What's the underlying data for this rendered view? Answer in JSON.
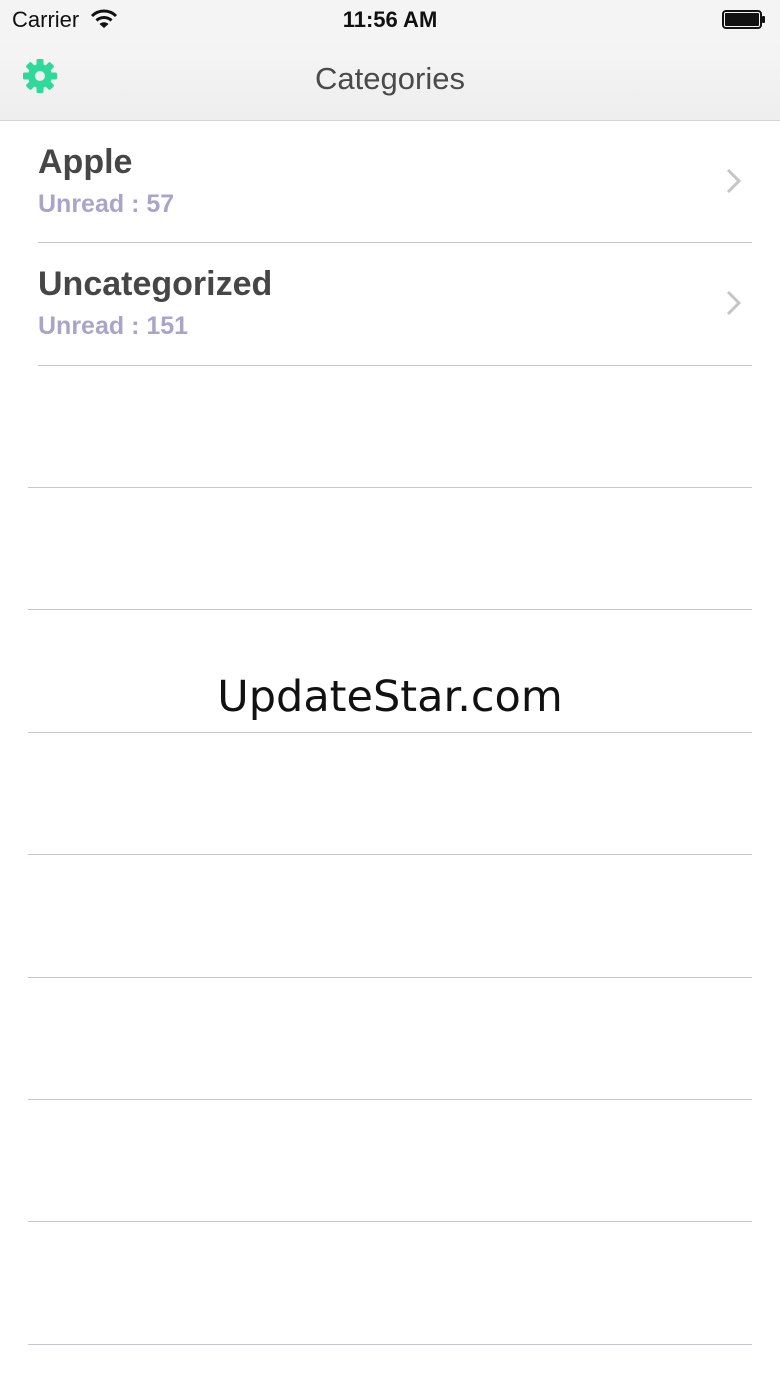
{
  "status_bar": {
    "carrier": "Carrier",
    "time": "11:56 AM"
  },
  "nav": {
    "title": "Categories",
    "settings_icon": "gear-icon",
    "accent_color": "#2ed99a"
  },
  "categories": [
    {
      "name": "Apple",
      "unread": "Unread : 57"
    },
    {
      "name": "Uncategorized",
      "unread": "Unread : 151"
    }
  ],
  "watermark": "UpdateStar.com"
}
